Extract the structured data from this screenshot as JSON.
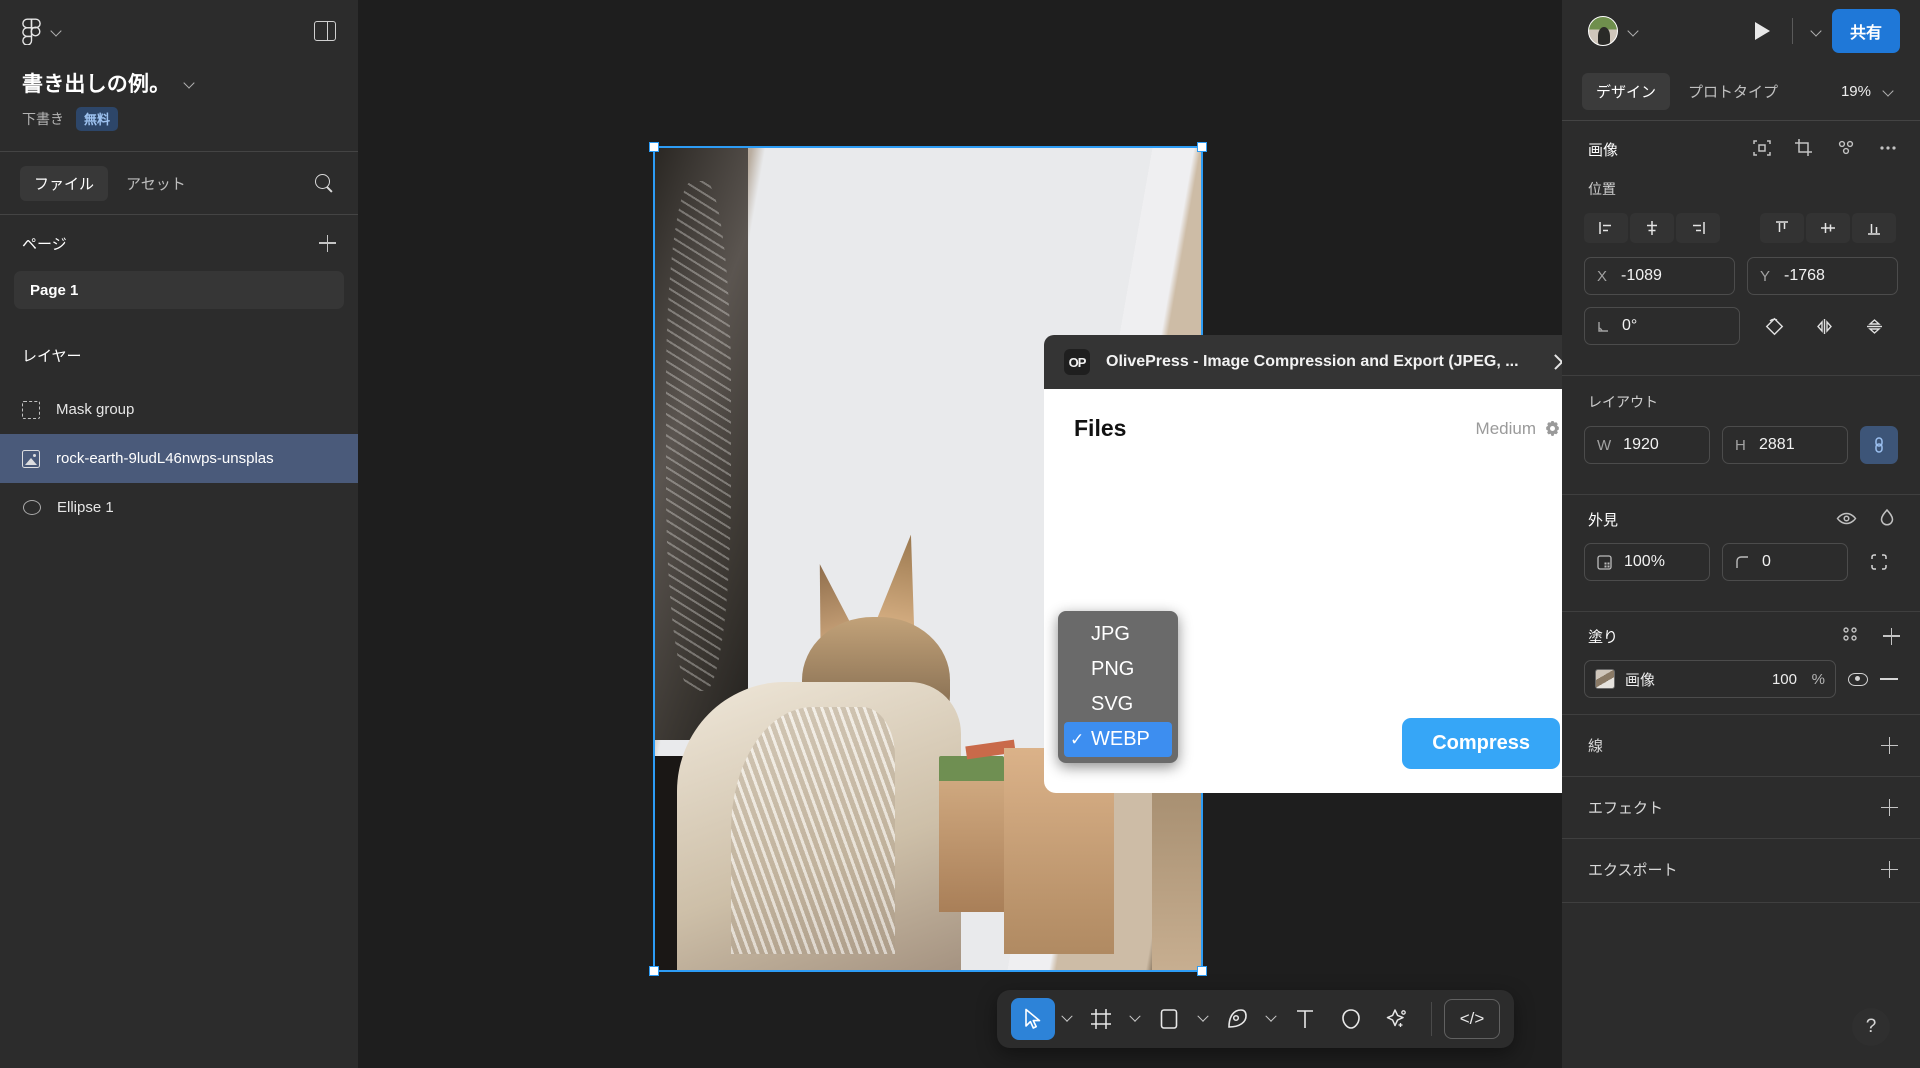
{
  "left_panel": {
    "logo_icon": "figma-logo-icon",
    "panel_toggle_icon": "panel-toggle-icon",
    "file_name": "書き出しの例。",
    "file_status": "下書き",
    "file_badge": "無料",
    "tabs": [
      {
        "label": "ファイル",
        "active": true
      },
      {
        "label": "アセット",
        "active": false
      }
    ],
    "search_icon": "search-icon",
    "pages_section": {
      "title": "ページ",
      "add_icon": "plus-icon"
    },
    "pages": [
      {
        "label": "Page 1",
        "selected": true
      }
    ],
    "layers_section": {
      "title": "レイヤー"
    },
    "layers": [
      {
        "label": "Mask group",
        "icon": "mask-icon",
        "selected": false
      },
      {
        "label": "rock-earth-9ludL46nwps-unsplas",
        "icon": "image-icon",
        "selected": true
      },
      {
        "label": "Ellipse 1",
        "icon": "ellipse-icon",
        "selected": false
      }
    ]
  },
  "modal": {
    "plugin_badge": "OP",
    "title": "OlivePress - Image Compression and Export (JPEG, ...",
    "close_icon": "close-icon",
    "files_heading": "Files",
    "quality_label": "Medium",
    "quality_gear_icon": "gear-icon",
    "add_file_icon": "plus-icon",
    "compress_label": "Compress"
  },
  "format_dropdown": {
    "items": [
      {
        "label": "JPG",
        "selected": false
      },
      {
        "label": "PNG",
        "selected": false
      },
      {
        "label": "SVG",
        "selected": false
      },
      {
        "label": "WEBP",
        "selected": true
      }
    ],
    "check_glyph": "✓"
  },
  "right_panel": {
    "avatar": "user-avatar",
    "avatar_caret_icon": "chevron-down-icon",
    "present_icon": "play-icon",
    "present_caret_icon": "chevron-down-icon",
    "share_label": "共有",
    "tabs": [
      {
        "label": "デザイン",
        "active": true
      },
      {
        "label": "プロトタイプ",
        "active": false
      }
    ],
    "zoom_level": "19%",
    "zoom_caret_icon": "chevron-down-icon",
    "selection_title": "画像",
    "selection_icons": [
      "component-icon",
      "crop-icon",
      "plugin-icon",
      "more-icon"
    ],
    "position": {
      "title": "位置",
      "align_left_icon": "align-left-icon",
      "align_center_h_icon": "align-center-horizontal-icon",
      "align_right_icon": "align-right-icon",
      "align_top_icon": "align-top-icon",
      "align_center_v_icon": "align-center-vertical-icon",
      "align_bottom_icon": "align-bottom-icon",
      "x_key": "X",
      "x_value": "-1089",
      "y_key": "Y",
      "y_value": "-1768",
      "rotation_key": "rotation-icon",
      "rotation_value": "0°",
      "flip_icons": [
        "rotate-icon",
        "flip-horizontal-icon",
        "flip-vertical-icon"
      ]
    },
    "layout": {
      "title": "レイアウト",
      "w_key": "W",
      "w_value": "1920",
      "h_key": "H",
      "h_value": "2881",
      "ratio_lock_icon": "link-icon"
    },
    "appearance": {
      "title": "外見",
      "visibility_icon": "eye-icon",
      "blend_icon": "blend-mode-icon",
      "opacity_icon": "opacity-icon",
      "opacity_value": "100%",
      "corner_icon": "corner-radius-icon",
      "corner_value": "0",
      "individual_corners_icon": "independent-corners-icon"
    },
    "fill": {
      "title": "塗り",
      "styles_icon": "styles-icon",
      "add_icon": "plus-icon",
      "paint_name": "画像",
      "paint_opacity": "100",
      "paint_unit": "%",
      "visibility_icon": "eye-icon",
      "remove_icon": "minus-icon"
    },
    "sections": [
      {
        "title": "線",
        "add_icon": "plus-icon"
      },
      {
        "title": "エフェクト",
        "add_icon": "plus-icon"
      },
      {
        "title": "エクスポート",
        "add_icon": "plus-icon"
      }
    ],
    "help_label": "?"
  },
  "toolbar": {
    "tools": [
      {
        "name": "move-tool",
        "active": true,
        "caret": true
      },
      {
        "name": "frame-tool",
        "active": false,
        "caret": true
      },
      {
        "name": "shape-tool",
        "active": false,
        "caret": true
      },
      {
        "name": "pen-tool",
        "active": false,
        "caret": true
      },
      {
        "name": "text-tool",
        "active": false,
        "caret": false
      },
      {
        "name": "comment-tool",
        "active": false,
        "caret": false
      },
      {
        "name": "actions-tool",
        "active": false,
        "caret": false
      }
    ],
    "dev_mode_label": "</>"
  },
  "colors": {
    "accent_blue": "#2d9cf5",
    "share_blue": "#1f78d8",
    "selected_layer": "#4a5a7a",
    "dropdown_highlight": "#3d8ef0",
    "panel_bg": "#2c2c2c",
    "canvas_bg": "#1e1e1e"
  }
}
